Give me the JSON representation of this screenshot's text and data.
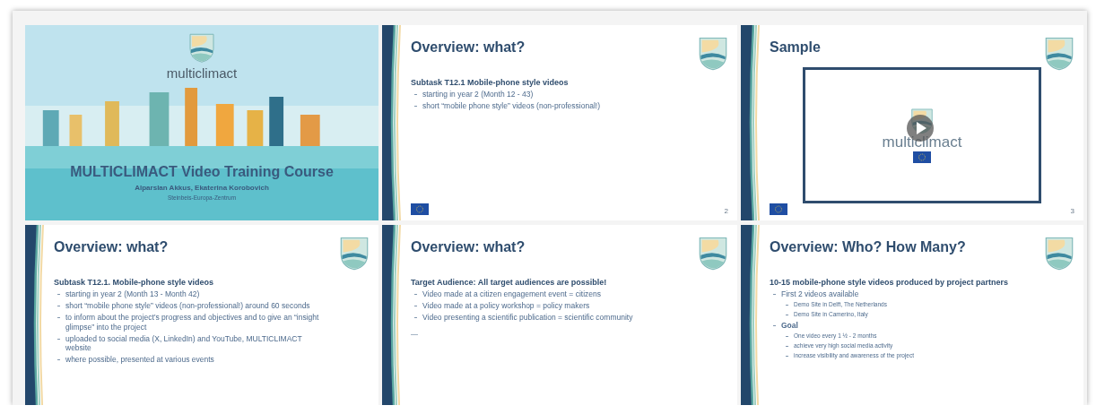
{
  "slides": [
    {
      "kind": "title",
      "logo_text": "multiclimact",
      "title": "MULTICLIMACT Video Training Course",
      "authors": "Alparslan Akkus, Ekaterina Korobovich",
      "institution": "Steinbeis-Europa-Zentrum"
    },
    {
      "kind": "content",
      "title": "Overview: what?",
      "heading": "Subtask T12.1 Mobile-phone style videos",
      "bullets": [
        {
          "text": "starting in year 2 (Month 12 - 43)"
        },
        {
          "text": "short “mobile phone style” videos (non-professional!)"
        }
      ],
      "number": "2"
    },
    {
      "kind": "video",
      "title": "Sample",
      "video_logo_text": "multiclimact",
      "number": "3"
    },
    {
      "kind": "content",
      "title": "Overview: what?",
      "heading": "Subtask T12.1. Mobile-phone style videos",
      "bullets": [
        {
          "text": "starting in year 2  (Month 13 - Month 42)"
        },
        {
          "text": "short “mobile phone style” videos (non-professional!) around 60 seconds"
        },
        {
          "text": "to inform about the project’s progress and objectives and to give an “insight glimpse” into the project"
        },
        {
          "text": "uploaded to social media (X, LinkedIn) and YouTube, MULTICLIMACT website"
        },
        {
          "text": "where possible, presented at various events"
        }
      ]
    },
    {
      "kind": "content",
      "title": "Overview: what?",
      "heading": "Target Audience: All target audiences are possible!",
      "bullets": [
        {
          "text": "Video made at a citizen engagement event = citizens"
        },
        {
          "text": "Video made at a policy workshop = policy makers"
        },
        {
          "text": "Video presenting a scientific publication = scientific community"
        }
      ],
      "after": "—"
    },
    {
      "kind": "content",
      "title": "Overview: Who? How Many?",
      "heading": "10-15 mobile-phone style videos produced by project partners",
      "bullets": [
        {
          "text": "First 2 videos available",
          "children": [
            {
              "text": "Demo Site in Delft, The Netherlands"
            },
            {
              "text": "Demo Site in Camerino, Italy"
            }
          ]
        },
        {
          "text": "Goal",
          "bold": true,
          "children": [
            {
              "text": "One video every 1 ½ - 2 months"
            },
            {
              "text": "achieve very high social media activity"
            },
            {
              "text": "increase visibility and awareness of the project"
            }
          ]
        }
      ]
    }
  ]
}
